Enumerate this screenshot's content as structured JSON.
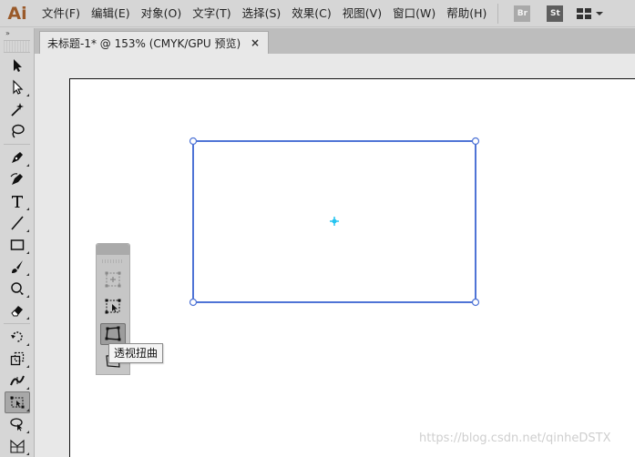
{
  "app": {
    "logo": "Ai"
  },
  "menu": {
    "items": [
      "文件(F)",
      "编辑(E)",
      "对象(O)",
      "文字(T)",
      "选择(S)",
      "效果(C)",
      "视图(V)",
      "窗口(W)",
      "帮助(H)"
    ]
  },
  "bridge_button": "Br",
  "stock_button": "St",
  "tab": {
    "title": "未标题-1* @ 153% (CMYK/GPU 预览)",
    "close": "×"
  },
  "toolbar": {
    "grip": "»"
  },
  "tooltip": "透视扭曲",
  "watermark": "https://blog.csdn.net/qinheDSTX",
  "colors": {
    "selection": "#4f74d6",
    "center_point": "#25c4f0",
    "artboard": "#ffffff",
    "canvas": "#e8e8e8"
  }
}
